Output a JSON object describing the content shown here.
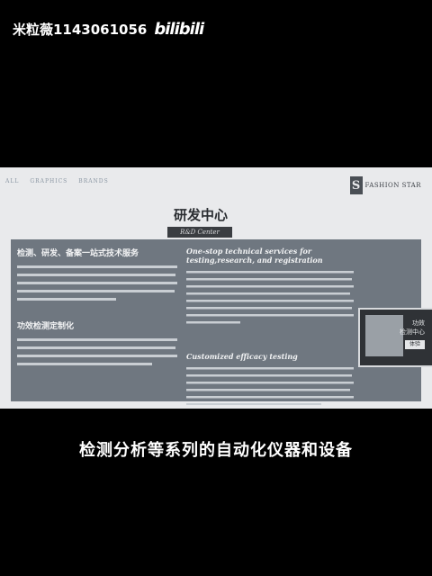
{
  "watermark": {
    "user": "米粒薇1143061056",
    "logo": "bilibili"
  },
  "nav": {
    "items": [
      {
        "label": "ALL"
      },
      {
        "label": "GRAPHICS"
      },
      {
        "label": "BRANDS"
      }
    ]
  },
  "brand": {
    "mark": "S",
    "text": "FASHION STAR"
  },
  "section": {
    "title_cn": "研发中心",
    "subtitle_en": "R&D Center"
  },
  "left_column": {
    "heading1": "检测、研发、备案一站式技术服务",
    "heading2": "功效检测定制化"
  },
  "right_column": {
    "heading1": "One-stop technical services for testing,research, and registration",
    "heading2": "Customized efficacy testing"
  },
  "thumbnail": {
    "label_line1": "功效",
    "label_line2": "检测中心",
    "bar": "体验"
  },
  "caption": {
    "text": "检测分析等系列的自动化仪器和设备"
  },
  "colors": {
    "panel": "#6f7780",
    "page_bg": "#e9eaec",
    "caption": "#ffffff"
  }
}
